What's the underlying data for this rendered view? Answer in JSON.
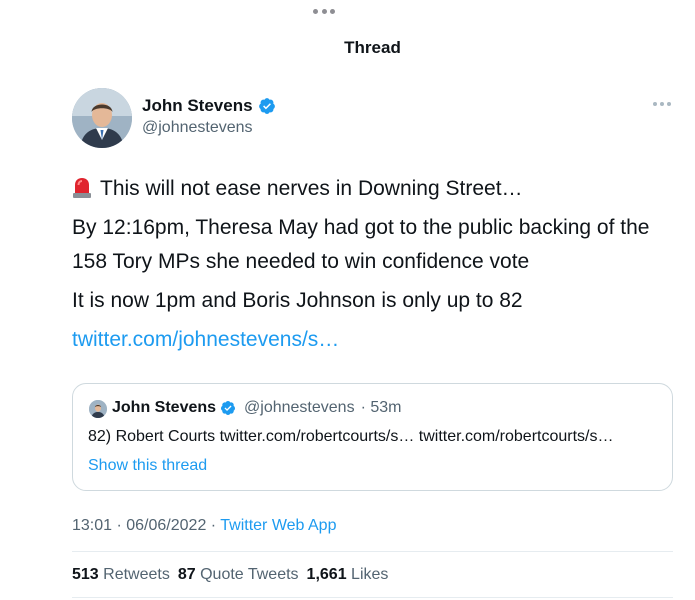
{
  "header": {
    "title": "Thread"
  },
  "tweet": {
    "author_name": "John Stevens",
    "handle": "@johnestevens",
    "lines": [
      "This will not ease nerves in Downing Street…",
      "By 12:16pm, Theresa May had got to the public backing of the 158 Tory MPs she needed to win confidence vote",
      "It is now 1pm and Boris Johnson is only up to 82"
    ],
    "link": "twitter.com/johnestevens/s…",
    "timestamp": "13:01 · 06/06/2022 · ",
    "app": "Twitter Web App"
  },
  "quote": {
    "author_name": "John Stevens",
    "handle": "@johnestevens",
    "time": "· 53m",
    "text": "82) Robert Courts twitter.com/robertcourts/s… twitter.com/robertcourts/s…",
    "show_thread": "Show this thread"
  },
  "stats": {
    "retweets": "513",
    "retweets_label": "Retweets",
    "quotes": "87",
    "quotes_label": "Quote Tweets",
    "likes": "1,661",
    "likes_label": "Likes"
  },
  "colors": {
    "accent": "#1d9bf0",
    "text": "#0f1419",
    "secondary": "#536471"
  },
  "icons": [
    "siren-emoji-icon",
    "verified-badge-icon",
    "more-options-icon"
  ]
}
